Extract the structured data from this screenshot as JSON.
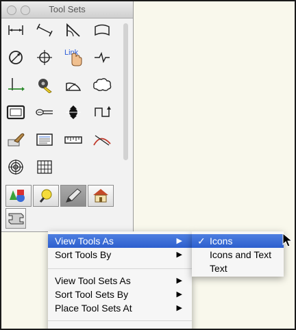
{
  "palette": {
    "title": "Tool Sets",
    "tools": [
      "dimension-icon",
      "angled-dimension-icon",
      "radial-dimension-icon",
      "arc-dimension-icon",
      "diameter-icon",
      "crosshair-icon",
      "link-icon",
      "break-line-icon",
      "origin-icon",
      "tape-measure-icon",
      "protractor-icon",
      "cloud-icon",
      "rectangle-icon",
      "pointer-line-icon",
      "section-marker-icon",
      "step-line-icon",
      "eyedropper-icon",
      "notes-icon",
      "ruler-icon",
      "curve-icon",
      "target-icon",
      "grid-icon"
    ],
    "link_label": "Link",
    "tabs": [
      "shapes-tab-icon",
      "light-tab-icon",
      "pencil-tab-icon",
      "house-tab-icon",
      "beam-tab-icon"
    ],
    "selected_tab": 2
  },
  "menu": {
    "items": [
      {
        "label": "View Tools As",
        "arrow": "▶",
        "highlighted": true
      },
      {
        "label": "Sort Tools By",
        "arrow": "▶"
      },
      {
        "label": "View Tool Sets As",
        "arrow": "▶"
      },
      {
        "label": "Sort Tool Sets By",
        "arrow": "▶"
      },
      {
        "label": "Place Tool Sets At",
        "arrow": "▶"
      }
    ]
  },
  "submenu": {
    "items": [
      {
        "label": "Icons",
        "checked": "✓",
        "highlighted": true
      },
      {
        "label": "Icons and Text"
      },
      {
        "label": "Text"
      }
    ]
  },
  "colors": {
    "highlight": "#3a6bd6",
    "canvas": "#f9f8ec",
    "link": "#2a5bd7"
  }
}
